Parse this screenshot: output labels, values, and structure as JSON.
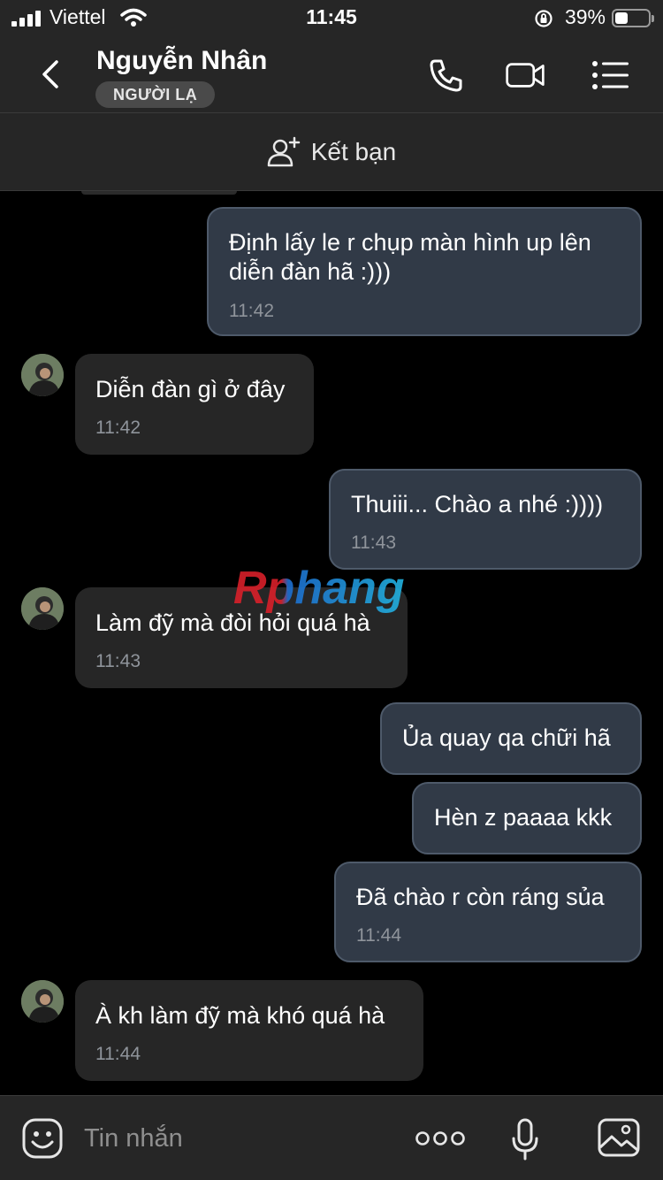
{
  "status_bar": {
    "carrier": "Viettel",
    "time": "11:45",
    "battery_percent": "39%",
    "battery_level": 0.39
  },
  "header": {
    "contact_name": "Nguyễn Nhân",
    "badge": "NGƯỜI LẠ"
  },
  "add_friend": {
    "label": "Kết bạn"
  },
  "watermark": "Rphang",
  "messages": [
    {
      "direction": "out",
      "text": "Định lấy le r chụp màn hình up lên diễn đàn hã :)))",
      "time": "11:42"
    },
    {
      "direction": "in",
      "text": "Diễn đàn gì ở đây",
      "time": "11:42"
    },
    {
      "direction": "out",
      "text": "Thuiii... Chào a nhé :))))",
      "time": "11:43"
    },
    {
      "direction": "in",
      "text": "Làm đỹ mà đòi hỏi quá hà",
      "time": "11:43"
    },
    {
      "direction": "out",
      "text": "Ủa quay qa chữi hã",
      "time": ""
    },
    {
      "direction": "out",
      "text": "Hèn z paaaa kkk",
      "time": ""
    },
    {
      "direction": "out",
      "text": "Đã chào r còn ráng sủa",
      "time": "11:44"
    },
    {
      "direction": "in",
      "text": "À kh làm đỹ mà khó quá hà",
      "time": "11:44"
    }
  ],
  "composer": {
    "placeholder": "Tin nhắn"
  },
  "colors": {
    "bar_bg": "#262626",
    "outgoing_bubble": "#313a47",
    "incoming_bubble": "#262626",
    "timestamp": "#8f949b"
  }
}
